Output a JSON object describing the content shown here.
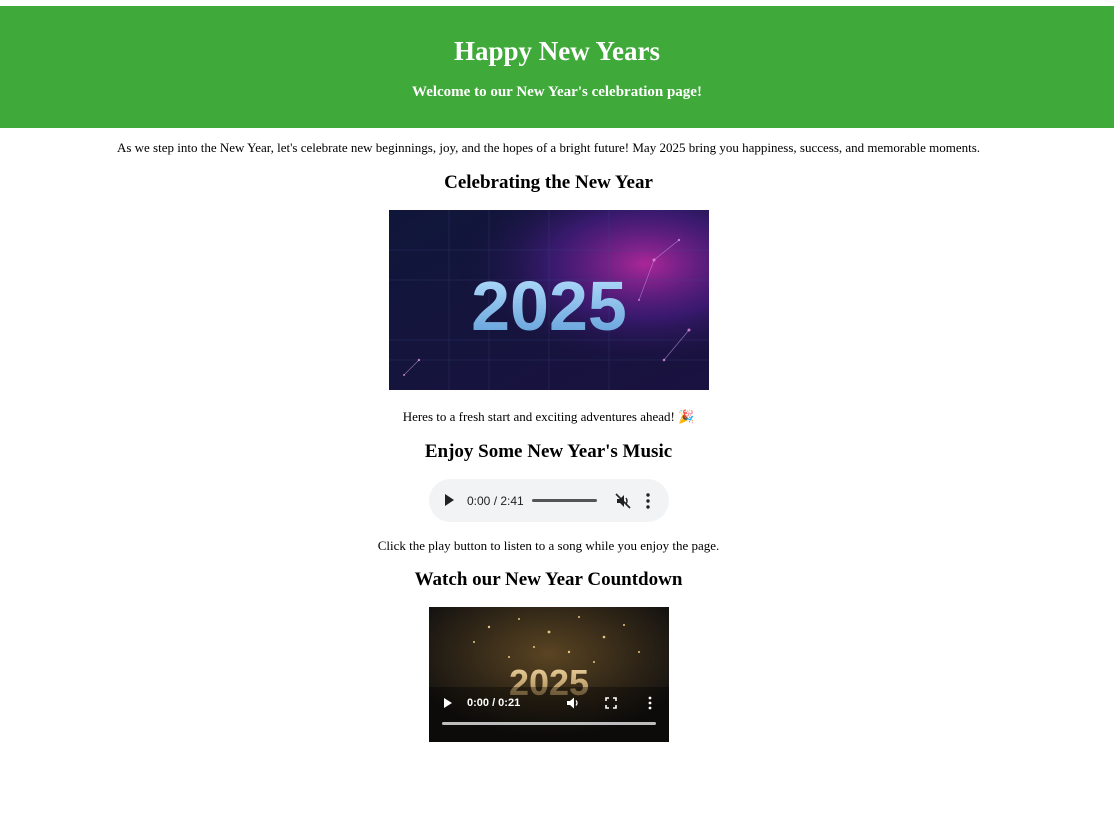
{
  "header": {
    "title": "Happy New Years",
    "subtitle": "Welcome to our New Year's celebration page!"
  },
  "intro": "As we step into the New Year, let's celebrate new beginnings, joy, and the hopes of a bright future! May 2025 bring you happiness, success, and memorable moments.",
  "sections": {
    "celebrating": {
      "heading": "Celebrating the New Year",
      "image_text": "2025",
      "caption": "Heres to a fresh start and exciting adventures ahead! 🎉"
    },
    "music": {
      "heading": "Enjoy Some New Year's Music",
      "time": "0:00 / 2:41",
      "caption": "Click the play button to listen to a song while you enjoy the page."
    },
    "countdown": {
      "heading": "Watch our New Year Countdown",
      "video_text": "2025",
      "time": "0:00 / 0:21"
    }
  },
  "colors": {
    "header_bg": "#3fa93a",
    "header_text": "#ffffff"
  },
  "icons": {
    "audio_play": "play-icon",
    "audio_mute": "muted-speaker-icon",
    "audio_more": "more-vertical-icon",
    "video_play": "play-icon",
    "video_volume": "speaker-icon",
    "video_fullscreen": "fullscreen-icon",
    "video_more": "more-vertical-icon"
  }
}
